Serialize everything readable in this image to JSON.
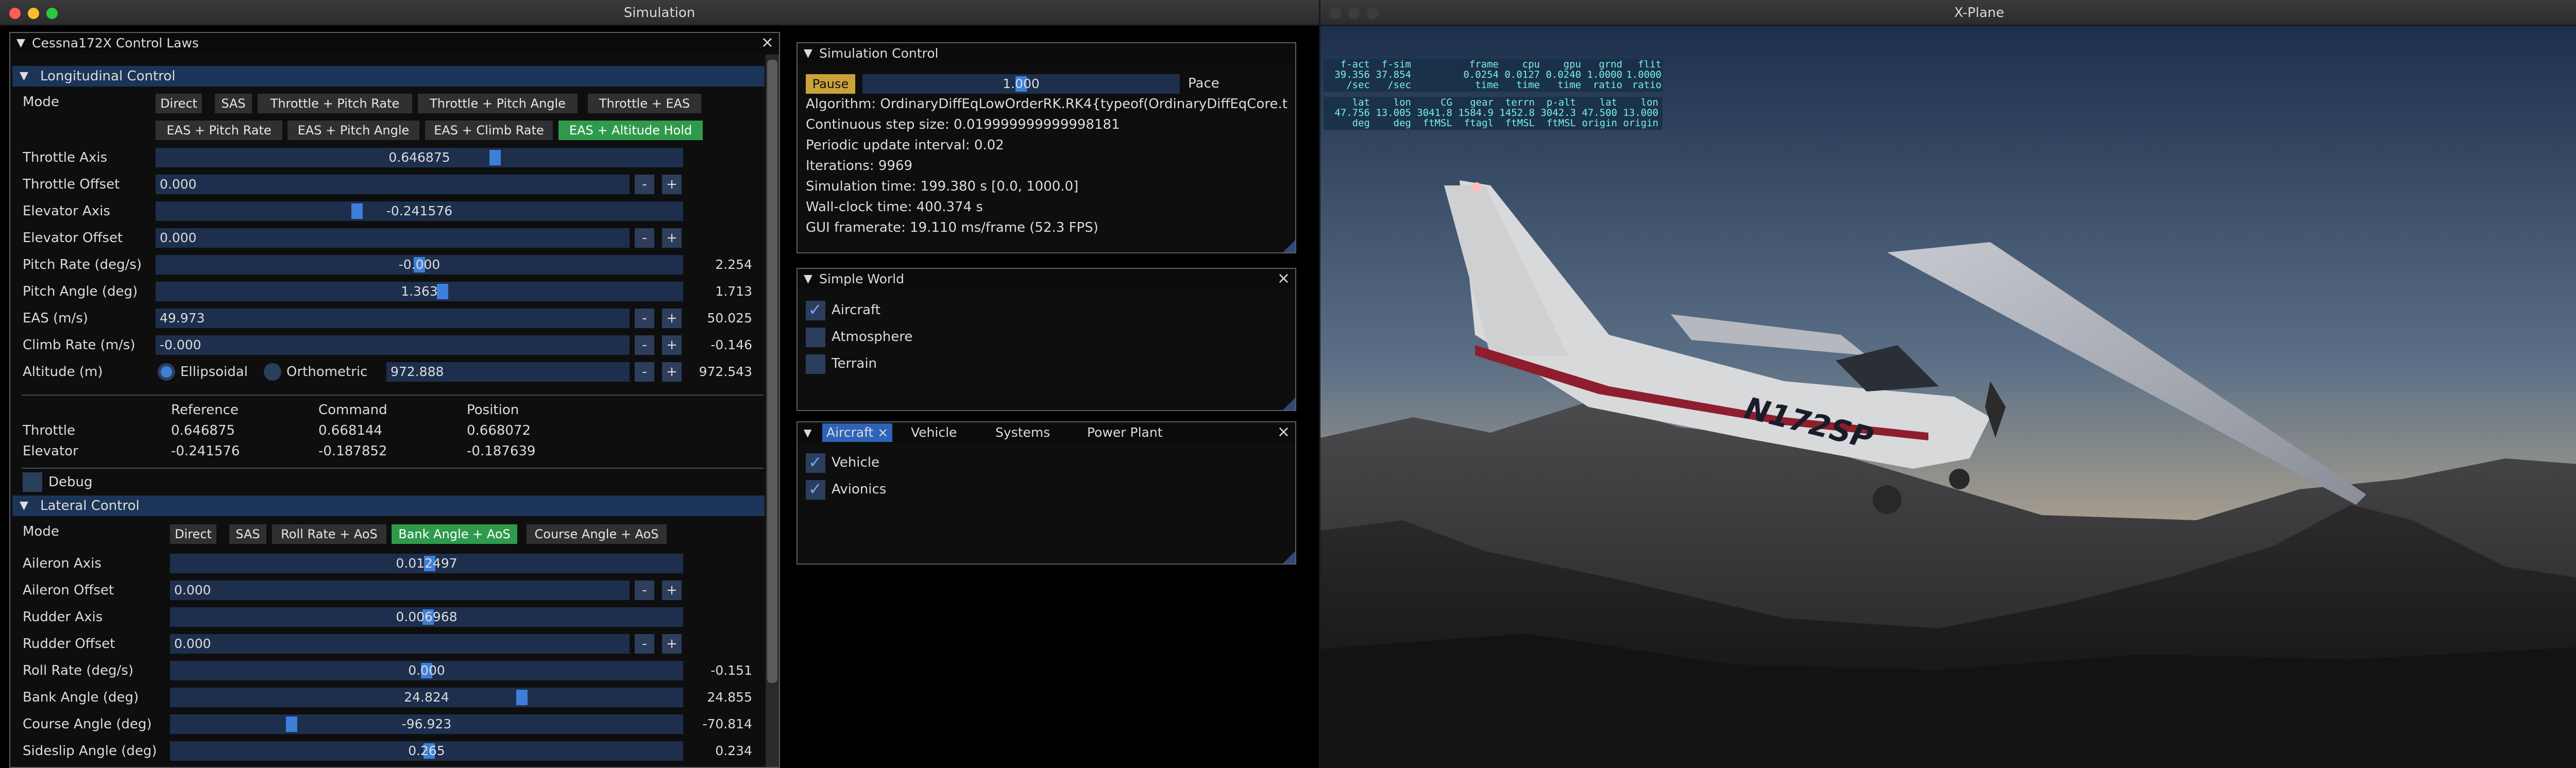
{
  "sim_window": {
    "title": "Simulation",
    "traffic_lights": [
      "#ff5f57",
      "#febc2e",
      "#28c840"
    ]
  },
  "xplane_window": {
    "title": "X-Plane",
    "traffic_lights": [
      "#3d3d3d",
      "#3d3d3d",
      "#3d3d3d"
    ]
  },
  "control": {
    "title": "Cessna172X Control Laws",
    "longitudinal": {
      "header": "Longitudinal Control",
      "mode_label": "Mode",
      "modes": [
        "Direct",
        "SAS",
        "Throttle + Pitch Rate",
        "Throttle + Pitch Angle",
        "Throttle + EAS",
        "EAS + Pitch Rate",
        "EAS + Pitch Angle",
        "EAS + Climb Rate",
        "EAS + Altitude Hold"
      ],
      "active_mode": "EAS + Altitude Hold",
      "throttle_axis": {
        "label": "Throttle Axis",
        "value": "0.646875",
        "frac": 0.646875
      },
      "throttle_offset": {
        "label": "Throttle Offset",
        "value": "0.000"
      },
      "elevator_axis": {
        "label": "Elevator Axis",
        "value": "-0.241576",
        "frac": 0.3792
      },
      "elevator_offset": {
        "label": "Elevator Offset",
        "value": "0.000"
      },
      "pitch_rate": {
        "label": "Pitch Rate (deg/s)",
        "value": "-0.000",
        "readout": "2.254",
        "frac": 0.5
      },
      "pitch_angle": {
        "label": "Pitch Angle (deg)",
        "value": "1.363",
        "readout": "1.713",
        "frac": 0.545
      },
      "eas": {
        "label": "EAS (m/s)",
        "value": "49.973",
        "readout": "50.025"
      },
      "climb_rate": {
        "label": "Climb Rate (m/s)",
        "value": "-0.000",
        "readout": "-0.146"
      },
      "altitude": {
        "label": "Altitude (m)",
        "ellipsoidal": "Ellipsoidal",
        "orthometric": "Orthometric",
        "value": "972.888",
        "readout": "972.543"
      },
      "table": {
        "headers": [
          "Reference",
          "Command",
          "Position"
        ],
        "rows": [
          {
            "name": "Throttle",
            "values": [
              "0.646875",
              "0.668144",
              "0.668072"
            ]
          },
          {
            "name": "Elevator",
            "values": [
              "-0.241576",
              "-0.187852",
              "-0.187639"
            ]
          }
        ]
      },
      "debug_label": "Debug"
    },
    "lateral": {
      "header": "Lateral Control",
      "mode_label": "Mode",
      "modes": [
        "Direct",
        "SAS",
        "Roll Rate + AoS",
        "Bank Angle + AoS",
        "Course Angle + AoS"
      ],
      "active_mode": "Bank Angle + AoS",
      "aileron_axis": {
        "label": "Aileron Axis",
        "value": "0.012497",
        "frac": 0.506
      },
      "aileron_offset": {
        "label": "Aileron Offset",
        "value": "0.000"
      },
      "rudder_axis": {
        "label": "Rudder Axis",
        "value": "0.006968",
        "frac": 0.503
      },
      "rudder_offset": {
        "label": "Rudder Offset",
        "value": "0.000"
      },
      "roll_rate": {
        "label": "Roll Rate (deg/s)",
        "value": "0.000",
        "readout": "-0.151",
        "frac": 0.5
      },
      "bank_angle": {
        "label": "Bank Angle (deg)",
        "value": "24.824",
        "readout": "24.855",
        "frac": 0.69
      },
      "course_angle": {
        "label": "Course Angle (deg)",
        "value": "-96.923",
        "readout": "-70.814",
        "frac": 0.231
      },
      "sideslip": {
        "label": "Sideslip Angle (deg)",
        "value": "0.265",
        "readout": "0.234",
        "frac": 0.505
      }
    }
  },
  "sim_control": {
    "title": "Simulation Control",
    "pause": "Pause",
    "pace": {
      "value": "1.000",
      "label": "Pace",
      "frac": 0.5
    },
    "lines": [
      "Algorithm: OrdinaryDiffEqLowOrderRK.RK4{typeof(OrdinaryDiffEqCore.t",
      "Continuous step size: 0.019999999999998181",
      "Periodic update interval: 0.02",
      "Iterations: 9969",
      "Simulation time: 199.380 s [0.0, 1000.0]",
      "Wall-clock time: 400.374 s",
      "GUI framerate: 19.110 ms/frame (52.3 FPS)"
    ]
  },
  "simple_world": {
    "title": "Simple World",
    "items": [
      {
        "label": "Aircraft",
        "checked": true
      },
      {
        "label": "Atmosphere",
        "checked": false
      },
      {
        "label": "Terrain",
        "checked": false
      }
    ]
  },
  "aircraft": {
    "tabs": [
      "Aircraft",
      "Vehicle",
      "Systems",
      "Power Plant"
    ],
    "items": [
      {
        "label": "Vehicle",
        "checked": true
      },
      {
        "label": "Avionics",
        "checked": true
      }
    ]
  },
  "xplane": {
    "tail_number": "N172SP",
    "hud1": {
      "headers": [
        "f-act",
        "f-sim",
        "frame",
        "cpu",
        "gpu",
        "grnd",
        "flit"
      ],
      "values": [
        "39.356",
        "37.854",
        "0.0254",
        "0.0127",
        "0.0240",
        "1.0000",
        "1.0000"
      ],
      "units": [
        "/sec",
        "/sec",
        "time",
        "time",
        "time",
        "ratio",
        "ratio"
      ]
    },
    "hud2": {
      "headers": [
        "lat",
        "lon",
        "CG",
        "gear",
        "terrn",
        "p-alt",
        "lat",
        "lon"
      ],
      "values": [
        "47.756",
        "13.005",
        "3041.8",
        "1584.9",
        "1452.8",
        "3042.3",
        "47.500",
        "13.000"
      ],
      "units": [
        "deg",
        "deg",
        "ftMSL",
        "ftagl",
        "ftMSL",
        "ftMSL",
        "origin",
        "origin"
      ]
    }
  }
}
